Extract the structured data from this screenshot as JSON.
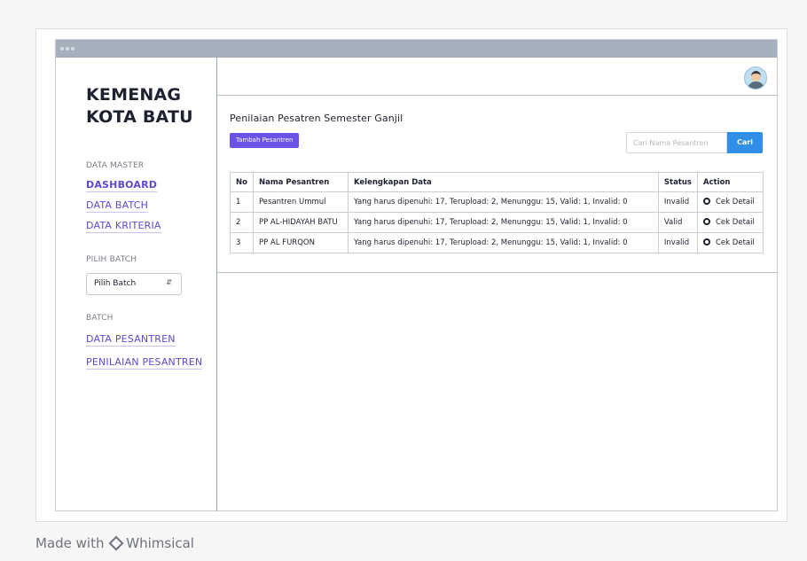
{
  "sidebar": {
    "brand_line1": "KEMENAG",
    "brand_line2": "KOTA BATU",
    "section_data_master": "DATA MASTER",
    "link_dashboard": "DASHBOARD",
    "link_data_batch": "DATA BATCH",
    "link_data_kriteria": "DATA KRITERIA",
    "section_pilih_batch": "PILIH BATCH",
    "batch_select_value": "Pilih Batch",
    "section_batch": "BATCH",
    "link_data_pesantren": "DATA PESANTREN",
    "link_penilaian_pesantren": "PENILAIAN PESANTREN"
  },
  "main": {
    "page_title": "Penilaian Pesatren Semester Ganjil",
    "add_button": "Tambah Pesantren",
    "search_placeholder": "Cari Nama Pesantren",
    "search_button": "Cari"
  },
  "table": {
    "headers": [
      "No",
      "Nama Pesantren",
      "Kelengkapan Data",
      "Status",
      "Action"
    ],
    "rows": [
      {
        "no": "1",
        "name": "Pesantren Ummul",
        "data": "Yang harus dipenuhi: 17, Terupload: 2, Menunggu: 15, Valid: 1, Invalid: 0",
        "status": "Invalid",
        "action": "Cek Detail"
      },
      {
        "no": "2",
        "name": "PP AL-HIDAYAH BATU",
        "data": "Yang harus dipenuhi: 17, Terupload: 2, Menunggu: 15, Valid: 1, Invalid: 0",
        "status": "Valid",
        "action": "Cek Detail"
      },
      {
        "no": "3",
        "name": "PP AL FURQON",
        "data": "Yang harus dipenuhi: 17, Terupload: 2, Menunggu: 15, Valid: 1, Invalid: 0",
        "status": "Invalid",
        "action": "Cek Detail"
      }
    ]
  },
  "footer": {
    "made_with": "Made with",
    "brand": "Whimsical"
  },
  "colors": {
    "accent_link": "#5a4bd1",
    "primary_button": "#6b52e8",
    "search_button": "#2f8fe6"
  }
}
